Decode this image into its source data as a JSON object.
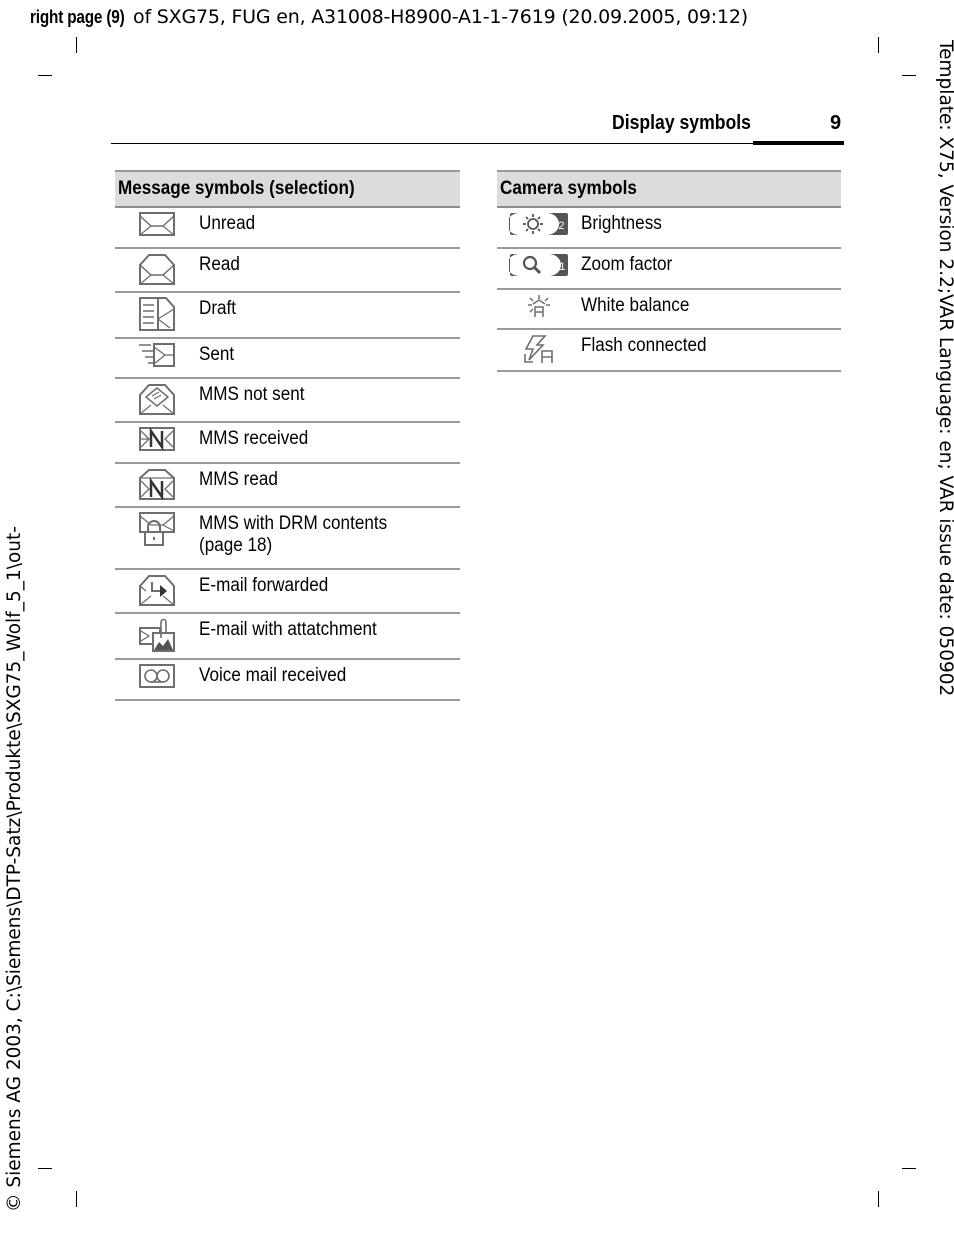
{
  "print_header": {
    "bold_prefix": "right page (9)",
    "rest": " of SXG75, FUG en, A31008-H8900-A1-1-7619 (20.09.2005, 09:12)"
  },
  "side_text_right": "Template: X75, Version 2.2;VAR Language: en; VAR issue date: 050902",
  "side_text_left": "© Siemens AG 2003, C:\\Siemens\\DTP-Satz\\Produkte\\SXG75_Wolf_5_1\\out-",
  "page_header": {
    "title": "Display symbols",
    "page_number": "9"
  },
  "message_table": {
    "heading": "Message symbols (selection)",
    "rows": [
      {
        "icon": "envelope-unread-icon",
        "label": "Unread"
      },
      {
        "icon": "envelope-read-icon",
        "label": "Read"
      },
      {
        "icon": "draft-icon",
        "label": "Draft"
      },
      {
        "icon": "sent-icon",
        "label": "Sent"
      },
      {
        "icon": "mms-not-sent-icon",
        "label": "MMS not sent"
      },
      {
        "icon": "mms-received-icon",
        "label": "MMS received"
      },
      {
        "icon": "mms-read-icon",
        "label": "MMS read"
      },
      {
        "icon": "mms-drm-lock-icon",
        "label": "MMS with DRM contents",
        "label2": "(page 18)"
      },
      {
        "icon": "email-forwarded-icon",
        "label": "E-mail forwarded"
      },
      {
        "icon": "email-attachment-icon",
        "label": "E-mail with attatchment"
      },
      {
        "icon": "voicemail-icon",
        "label": "Voice mail received"
      }
    ]
  },
  "camera_table": {
    "heading": "Camera symbols",
    "rows": [
      {
        "icon": "brightness-icon",
        "label": "Brightness",
        "badge": "+2"
      },
      {
        "icon": "zoom-factor-icon",
        "label": "Zoom factor",
        "badge": "×1"
      },
      {
        "icon": "white-balance-icon",
        "label": "White balance"
      },
      {
        "icon": "flash-connected-icon",
        "label": "Flash connected"
      }
    ]
  }
}
